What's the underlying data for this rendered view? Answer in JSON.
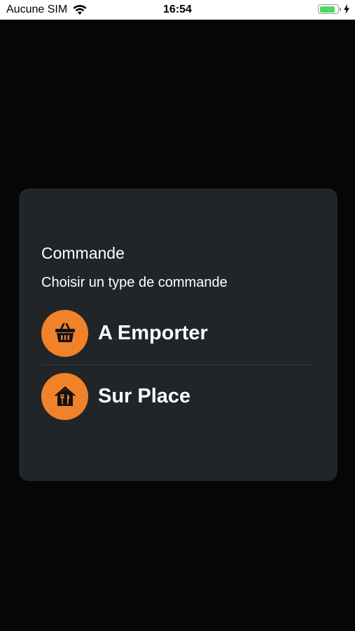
{
  "status_bar": {
    "carrier": "Aucune SIM",
    "time": "16:54",
    "battery_level": 0.9,
    "battery_color": "#4cd964"
  },
  "dialog": {
    "title": "Commande",
    "subtitle": "Choisir un type de commande",
    "options": [
      {
        "label": "A Emporter",
        "icon": "basket-icon"
      },
      {
        "label": "Sur Place",
        "icon": "restaurant-house-icon"
      }
    ],
    "accent_color": "#f0822a",
    "background_color": "#212528"
  }
}
